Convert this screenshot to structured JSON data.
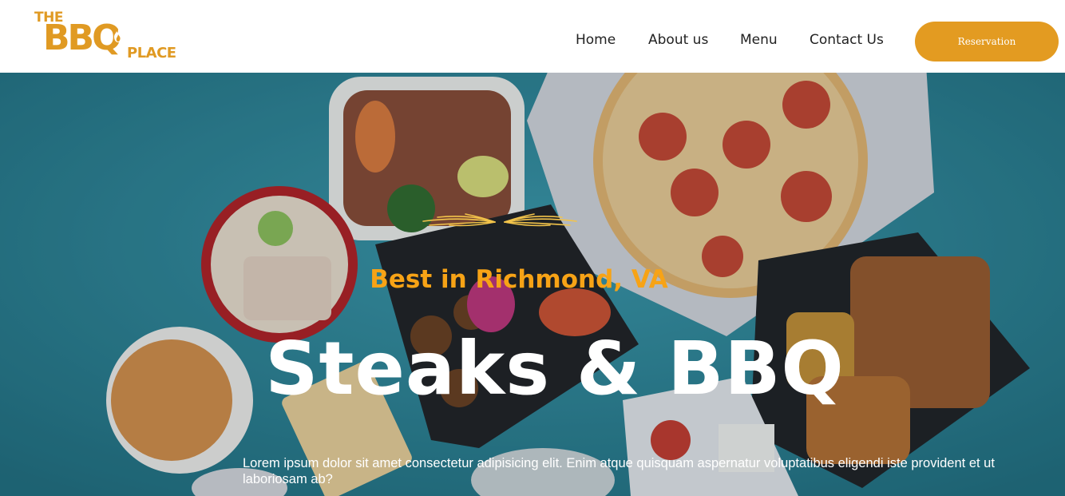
{
  "brand": {
    "logo_top": "THE",
    "logo_main": "BBQ",
    "logo_bottom": "PLACE"
  },
  "nav": {
    "items": [
      "Home",
      "About us",
      "Menu",
      "Contact Us"
    ],
    "reservation_label": "Reservation"
  },
  "hero": {
    "kicker": "Best in Richmond, VA",
    "title": "Steaks & BBQ",
    "description": "Lorem ipsum dolor sit amet consectetur adipisicing elit. Enim atque quisquam aspernatur voluptatibus eligendi iste provident et ut laboriosam ab?"
  },
  "colors": {
    "accent": "#e39b21",
    "kicker": "#f7a316",
    "hero_bg": "#2b8a9b"
  }
}
